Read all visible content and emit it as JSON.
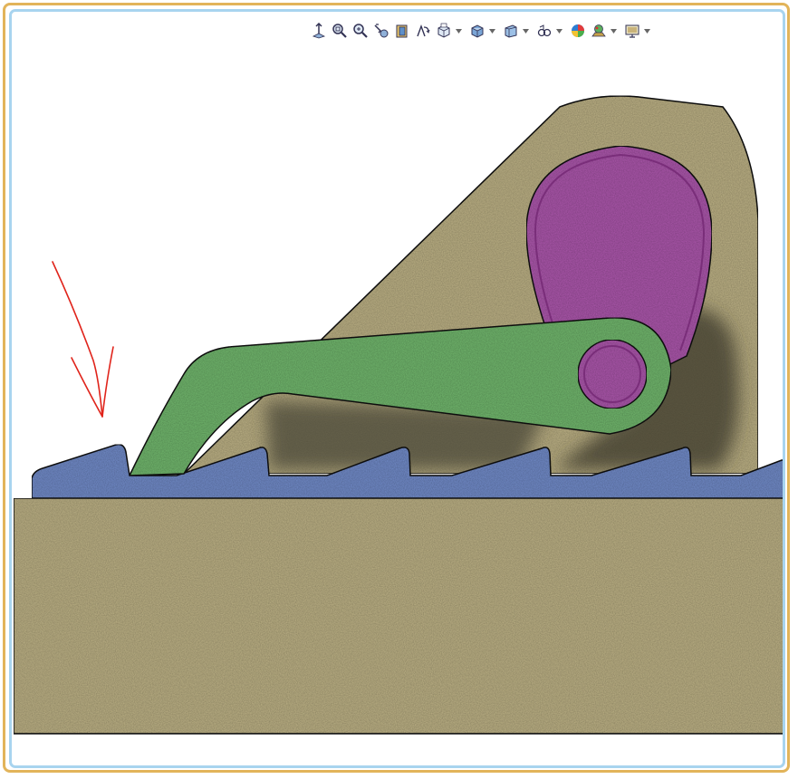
{
  "window": {
    "frame_color": "#e2b45a",
    "viewport_border_color": "#a8d4ef"
  },
  "toolbar": {
    "buttons": [
      {
        "icon": "view-orientation-icon",
        "has_dropdown": false
      },
      {
        "icon": "zoom-to-fit-icon",
        "has_dropdown": false
      },
      {
        "icon": "zoom-to-area-icon",
        "has_dropdown": false
      },
      {
        "icon": "previous-view-icon",
        "has_dropdown": false
      },
      {
        "icon": "section-view-icon",
        "has_dropdown": false
      },
      {
        "icon": "dynamic-annotation-icon",
        "has_dropdown": false
      },
      {
        "icon": "view-orientation-cube-icon",
        "has_dropdown": true
      },
      {
        "icon": "display-style-icon",
        "has_dropdown": true
      },
      {
        "icon": "hide-show-items-icon",
        "has_dropdown": true
      },
      {
        "icon": "view-settings-icon",
        "has_dropdown": true
      },
      {
        "icon": "edit-appearance-icon",
        "has_dropdown": false
      },
      {
        "icon": "apply-scene-icon",
        "has_dropdown": true
      },
      {
        "icon": "view-monitor-icon",
        "has_dropdown": true
      }
    ]
  },
  "model": {
    "base_color": "#b8ad82",
    "rack_color": "#6f88c4",
    "pawl_color": "#6fb36b",
    "cam_color": "#a855a8",
    "annotation_color": "#e0241b"
  }
}
